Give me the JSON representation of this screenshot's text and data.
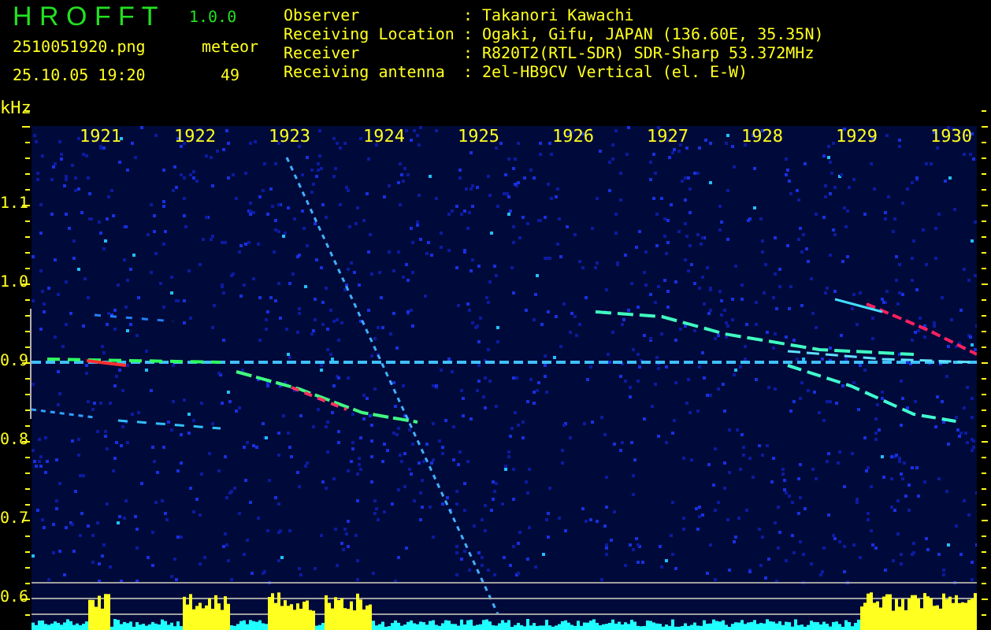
{
  "app": {
    "name": "H R O F F T",
    "version": "1.0.0"
  },
  "file": {
    "name": "2510051920.png",
    "datetime": "25.10.05 19:20"
  },
  "counter": {
    "label": "meteor",
    "value": "49"
  },
  "station": [
    {
      "label": "Observer",
      "separator": ":",
      "value": "Takanori Kawachi"
    },
    {
      "label": "Receiving Location",
      "separator": ":",
      "value": "Ogaki, Gifu, JAPAN (136.60E, 35.35N)"
    },
    {
      "label": "Receiver",
      "separator": ":",
      "value": "R820T2(RTL-SDR) SDR-Sharp 53.372MHz"
    },
    {
      "label": "Receiving antenna",
      "separator": ":",
      "value": "2el-HB9CV Vertical (el. E-W)"
    }
  ],
  "axis": {
    "unit": "kHz",
    "y_labels": [
      "1.1",
      "1.0",
      "0.9",
      "0.8",
      "0.7",
      "0.6"
    ],
    "x_labels": [
      "1921",
      "1922",
      "1923",
      "1924",
      "1925",
      "1926",
      "1927",
      "1928",
      "1929",
      "1930"
    ]
  }
}
